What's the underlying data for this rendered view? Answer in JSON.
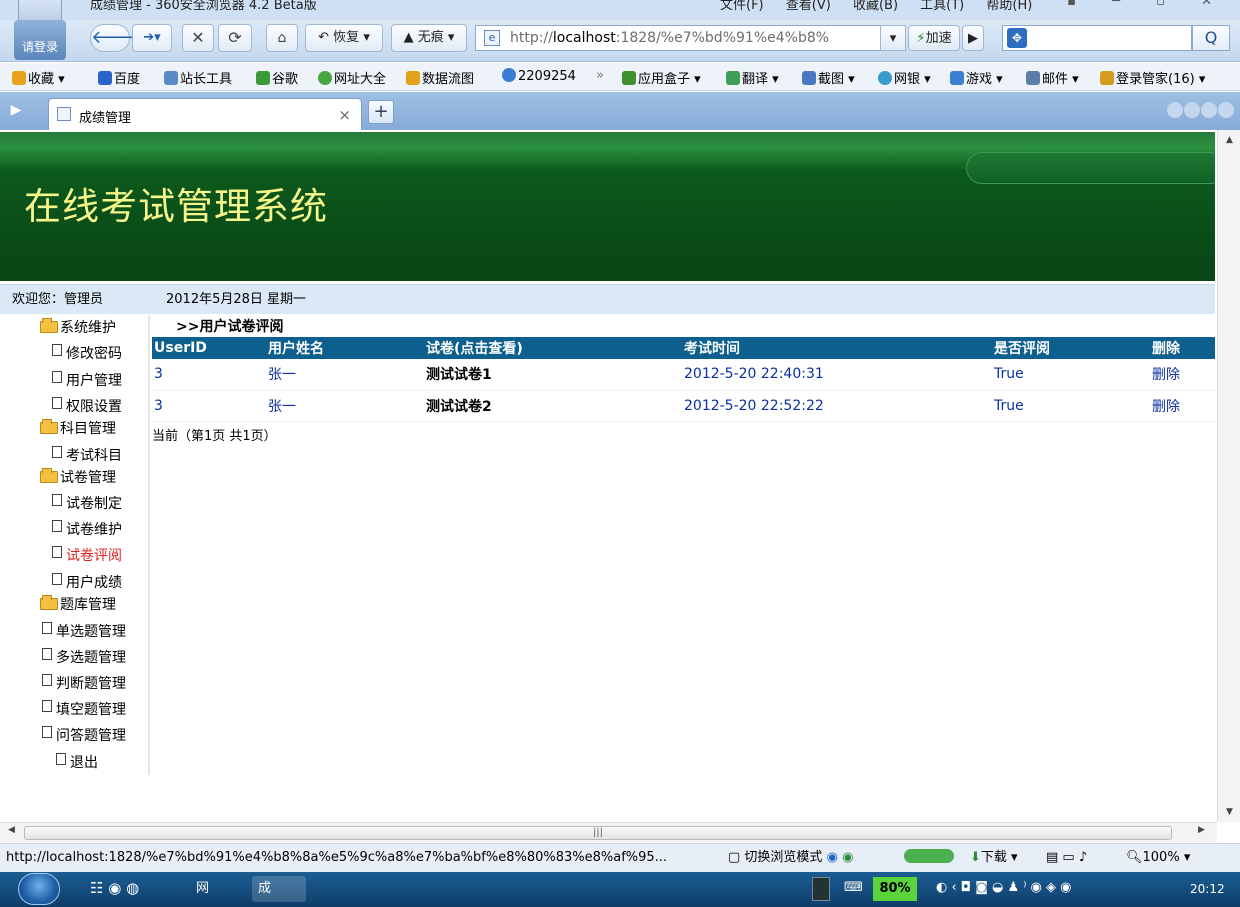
{
  "window": {
    "title": "成绩管理 - 360安全浏览器 4.2 Beta版",
    "menu": [
      "文件(F)",
      "查看(V)",
      "收藏(B)",
      "工具(T)",
      "帮助(H)"
    ]
  },
  "toolbar": {
    "login_label": "请登录",
    "restore_label": "恢复",
    "incognito_label": "无痕",
    "address_prefix": "http://",
    "address_host": "localhost",
    "address_rest": ":1828/%e7%bd%91%e4%b8%",
    "accelerate_label": "加速",
    "search_label": "Q"
  },
  "favorites": [
    {
      "label": "收藏",
      "color": "#e8a31c"
    },
    {
      "label": "百度",
      "color": "#2a63c9"
    },
    {
      "label": "站长工具",
      "color": "#5a89c8"
    },
    {
      "label": "谷歌",
      "color": "#3c9a3c"
    },
    {
      "label": "网址大全",
      "color": "#46a642"
    },
    {
      "label": "数据流图",
      "color": "#e0a21a"
    },
    {
      "label": "2209254",
      "color": "#3a7bd5"
    },
    {
      "label": "»",
      "color": ""
    },
    {
      "label": "应用盒子",
      "color": "#3f8f2f"
    },
    {
      "label": "翻译",
      "color": "#3f9f57"
    },
    {
      "label": "截图",
      "color": "#4a78c4"
    },
    {
      "label": "网银",
      "color": "#3a9ad0"
    },
    {
      "label": "游戏",
      "color": "#3a7fd0"
    },
    {
      "label": "邮件",
      "color": "#5b7ea8"
    },
    {
      "label": "登录管家(16)",
      "color": "#d49b1e"
    }
  ],
  "tab": {
    "label": "成绩管理",
    "close": "×",
    "new": "+"
  },
  "page": {
    "banner_title": "在线考试管理系统",
    "welcome": "欢迎您：管理员",
    "date": "2012年5月28日 星期一",
    "nav": [
      {
        "label": "系统维护",
        "type": "folder"
      },
      {
        "label": "修改密码",
        "type": "doc"
      },
      {
        "label": "用户管理",
        "type": "doc"
      },
      {
        "label": "权限设置",
        "type": "doc"
      },
      {
        "label": "科目管理",
        "type": "folder"
      },
      {
        "label": "考试科目",
        "type": "doc"
      },
      {
        "label": "试卷管理",
        "type": "folder"
      },
      {
        "label": "试卷制定",
        "type": "doc"
      },
      {
        "label": "试卷维护",
        "type": "doc"
      },
      {
        "label": "试卷评阅",
        "type": "doc",
        "active": true
      },
      {
        "label": "用户成绩",
        "type": "doc"
      },
      {
        "label": "题库管理",
        "type": "folder"
      },
      {
        "label": "单选题管理",
        "type": "doc"
      },
      {
        "label": "多选题管理",
        "type": "doc"
      },
      {
        "label": "判断题管理",
        "type": "doc"
      },
      {
        "label": "填空题管理",
        "type": "doc"
      },
      {
        "label": "问答题管理",
        "type": "doc"
      },
      {
        "label": "退出",
        "type": "doc"
      }
    ],
    "content_title": ">>用户试卷评阅",
    "columns": [
      "UserID",
      "用户姓名",
      "试卷(点击查看)",
      "考试时间",
      "是否评阅",
      "删除"
    ],
    "rows": [
      [
        "3",
        "张一",
        "测试试卷1",
        "2012-5-20 22:40:31",
        "True",
        "删除"
      ],
      [
        "3",
        "张一",
        "测试试卷2",
        "2012-5-20 22:52:22",
        "True",
        "删除"
      ]
    ],
    "pager": "当前（第1页 共1页）"
  },
  "statusbar": {
    "url": "http://localhost:1828/%e7%bd%91%e4%b8%8a%e5%9c%a8%e7%ba%bf%e8%80%83%e8%af%95...",
    "switch_mode": "切换浏览模式",
    "download": "下载",
    "zoom": "100%"
  },
  "taskbar": {
    "tasks": [
      "网",
      "成"
    ],
    "battery": "80%",
    "clock": "20:12"
  }
}
